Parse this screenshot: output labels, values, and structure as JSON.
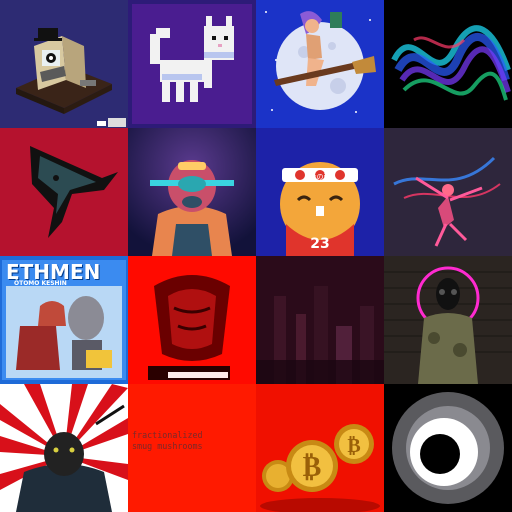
{
  "gallery": {
    "tiles": [
      {
        "name": "computer-robot"
      },
      {
        "name": "pixel-cat"
      },
      {
        "name": "witch-on-moon"
      },
      {
        "name": "neon-waves"
      },
      {
        "name": "shark-fin"
      },
      {
        "name": "astronaut-portrait"
      },
      {
        "name": "nugget-character",
        "headband": "香の弱",
        "jersey_number": "23"
      },
      {
        "name": "neon-dancer"
      },
      {
        "name": "ethmen-card",
        "title": "ETHMEN",
        "subtitle": "ŌTOMO KESHIN"
      },
      {
        "name": "red-statue"
      },
      {
        "name": "dark-city"
      },
      {
        "name": "gasmask-figure"
      },
      {
        "name": "panther-samurai"
      },
      {
        "name": "fractionalized-text",
        "caption": "fractionalized\nsmug mushrooms"
      },
      {
        "name": "bitcoin-coins"
      },
      {
        "name": "eye-ring"
      }
    ]
  },
  "colors": {
    "navy": "#2a2a6e",
    "purple": "#4d1a8a",
    "crimson": "#b5122e",
    "red": "#ff0a00",
    "black": "#000000"
  }
}
